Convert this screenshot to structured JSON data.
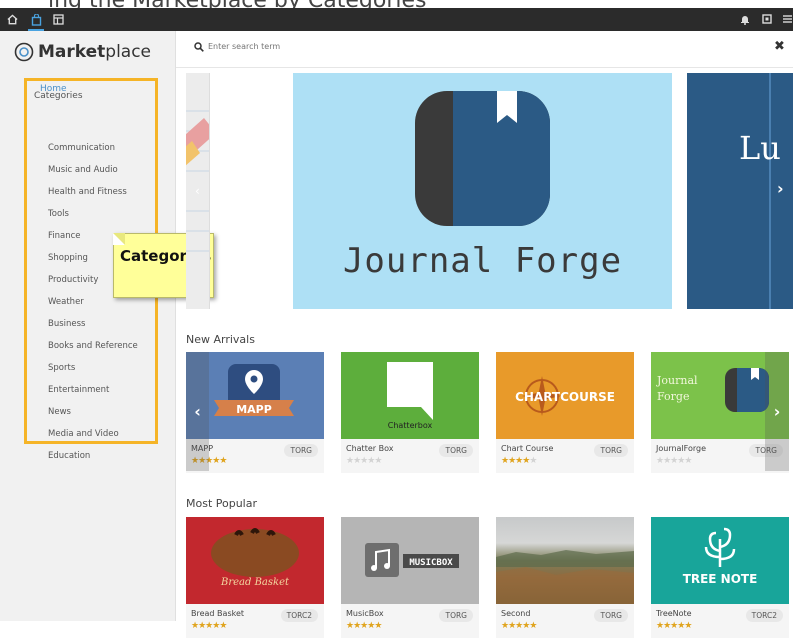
{
  "caption": "ing the Marketplace by Categories",
  "topbar": {
    "left_icons": [
      "home-icon",
      "marketplace-icon",
      "apps-icon"
    ],
    "right_icons": [
      "bell-icon",
      "square-icon",
      "menu-icon"
    ]
  },
  "logo": {
    "bold": "Market",
    "rest": "place"
  },
  "search": {
    "placeholder": "Enter search term"
  },
  "sidebar": {
    "home": "Home",
    "categories_title": "Categories",
    "categories": [
      "Communication",
      "Music and Audio",
      "Health and Fitness",
      "Tools",
      "Finance",
      "Shopping",
      "Productivity",
      "Weather",
      "Business",
      "Books and Reference",
      "Sports",
      "Entertainment",
      "News",
      "Media and Video",
      "Education"
    ]
  },
  "callout": {
    "label": "Categories"
  },
  "carousel": {
    "main_title": "Journal  Forge",
    "right_title": "Lu"
  },
  "new_arrivals": {
    "title": "New Arrivals",
    "cards": [
      {
        "name": "MAPP",
        "publisher": "TORG",
        "rating": 4.5,
        "logo_text": "MAPP"
      },
      {
        "name": "Chatter Box",
        "publisher": "TORG",
        "rating": 0,
        "logo_text": "Chatterbox"
      },
      {
        "name": "Chart Course",
        "publisher": "TORG",
        "rating": 3.5,
        "logo_text": "CHARTCOURSE"
      },
      {
        "name": "JournalForge",
        "publisher": "TORG",
        "rating": 0,
        "logo_text": "Journal Forge"
      }
    ]
  },
  "most_popular": {
    "title": "Most Popular",
    "cards": [
      {
        "name": "Bread Basket",
        "publisher": "TORC2",
        "rating": 5,
        "logo_text": "Bread Basket"
      },
      {
        "name": "MusicBox",
        "publisher": "TORG",
        "rating": 5,
        "logo_text": "MUSICBOX"
      },
      {
        "name": "Second",
        "publisher": "TORG",
        "rating": 5,
        "logo_text": ""
      },
      {
        "name": "TreeNote",
        "publisher": "TORC2",
        "rating": 4.5,
        "logo_text": "TREE NOTE"
      }
    ]
  },
  "colors": {
    "accent": "#f5b427",
    "link": "#4a90c8",
    "note": "#ffff99"
  }
}
